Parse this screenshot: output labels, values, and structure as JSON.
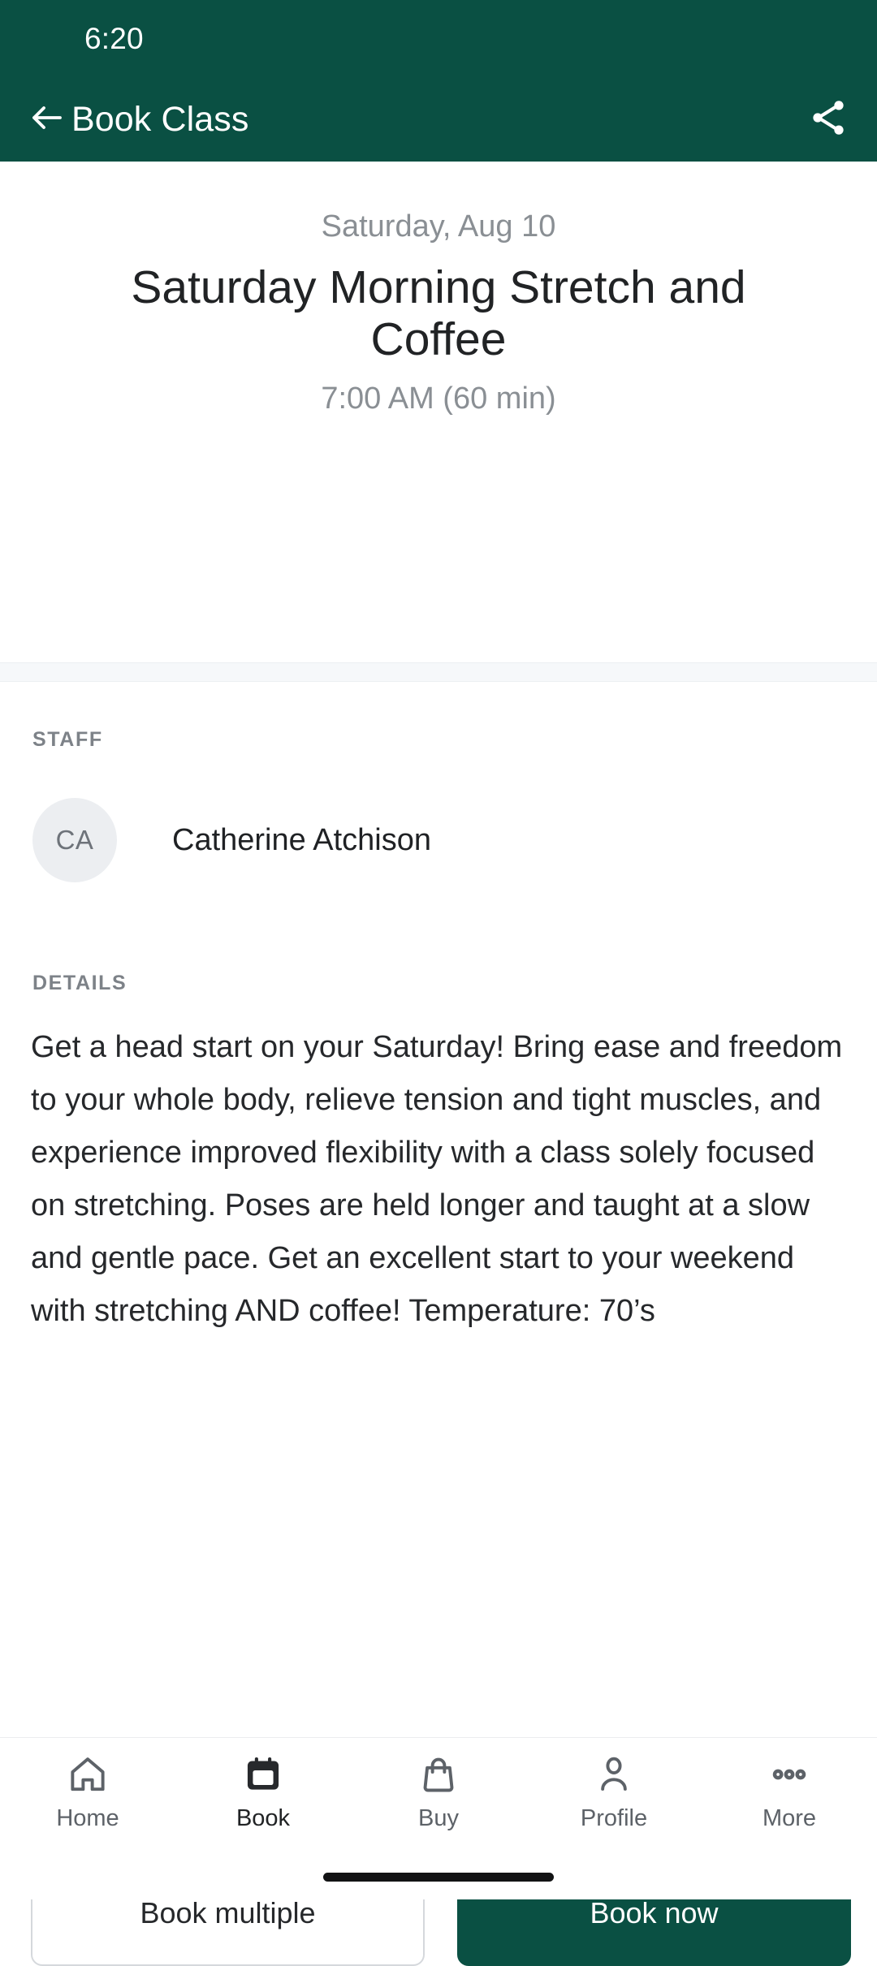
{
  "status_bar": {
    "time": "6:20"
  },
  "appbar": {
    "title": "Book Class",
    "back_icon": "arrow-left-icon",
    "share_icon": "share-icon",
    "background_color": "#0a5043",
    "foreground_color": "#ffffff"
  },
  "class": {
    "date": "Saturday, Aug 10",
    "title": "Saturday Morning Stretch and Coffee",
    "time": "7:00 AM (60 min)"
  },
  "staff": {
    "label": "STAFF",
    "member": {
      "initials": "CA",
      "name": "Catherine Atchison"
    }
  },
  "details": {
    "label": "DETAILS",
    "text": "Get a head start on your Saturday! Bring ease and freedom to your whole body, relieve tension and tight muscles, and experience improved flexibility with a class solely focused on stretching. Poses are held longer and taught at a slow and gentle pace. Get an excellent start to your weekend with stretching AND coffee! Temperature: 70’s"
  },
  "actions": {
    "secondary_label": "Book multiple",
    "primary_label": "Book now",
    "primary_color": "#0a5043"
  },
  "bottom_nav": {
    "items": [
      {
        "label": "Home",
        "icon": "home-icon",
        "active": false
      },
      {
        "label": "Book",
        "icon": "calendar-icon",
        "active": true
      },
      {
        "label": "Buy",
        "icon": "shopping-bag-icon",
        "active": false
      },
      {
        "label": "Profile",
        "icon": "person-icon",
        "active": false
      },
      {
        "label": "More",
        "icon": "more-dots-icon",
        "active": false
      }
    ]
  }
}
